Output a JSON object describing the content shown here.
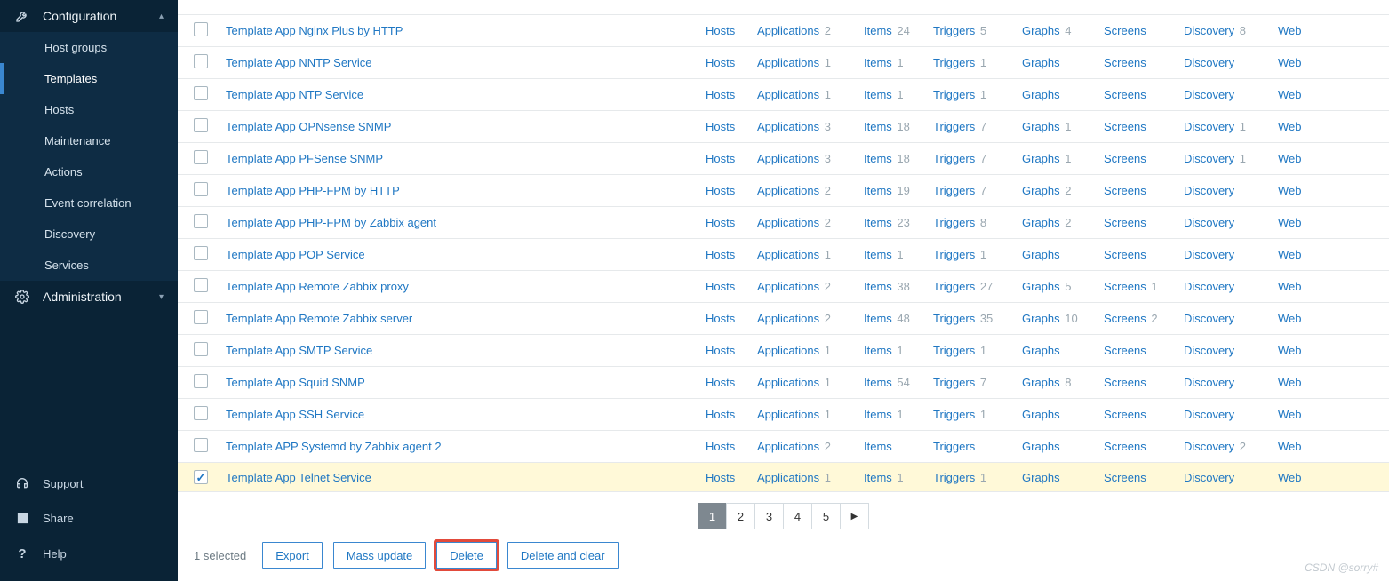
{
  "sidebar": {
    "sections": [
      {
        "label": "Configuration",
        "expanded": true,
        "items": [
          {
            "label": "Host groups",
            "active": false
          },
          {
            "label": "Templates",
            "active": true
          },
          {
            "label": "Hosts",
            "active": false
          },
          {
            "label": "Maintenance",
            "active": false
          },
          {
            "label": "Actions",
            "active": false
          },
          {
            "label": "Event correlation",
            "active": false
          },
          {
            "label": "Discovery",
            "active": false
          },
          {
            "label": "Services",
            "active": false
          }
        ]
      },
      {
        "label": "Administration",
        "expanded": false,
        "items": []
      }
    ],
    "footer": [
      {
        "label": "Support"
      },
      {
        "label": "Share"
      },
      {
        "label": "Help"
      }
    ]
  },
  "columns": {
    "hosts": "Hosts",
    "applications": "Applications",
    "items": "Items",
    "triggers": "Triggers",
    "graphs": "Graphs",
    "screens": "Screens",
    "discovery": "Discovery",
    "web": "Web"
  },
  "rows": [
    {
      "selected": false,
      "name": "Template App Nginx Plus by HTTP",
      "apps": 2,
      "items": 24,
      "triggers": 5,
      "graphs": 4,
      "screens": null,
      "discovery": 8
    },
    {
      "selected": false,
      "name": "Template App NNTP Service",
      "apps": 1,
      "items": 1,
      "triggers": 1,
      "graphs": null,
      "screens": null,
      "discovery": null
    },
    {
      "selected": false,
      "name": "Template App NTP Service",
      "apps": 1,
      "items": 1,
      "triggers": 1,
      "graphs": null,
      "screens": null,
      "discovery": null
    },
    {
      "selected": false,
      "name": "Template App OPNsense SNMP",
      "apps": 3,
      "items": 18,
      "triggers": 7,
      "graphs": 1,
      "screens": null,
      "discovery": 1
    },
    {
      "selected": false,
      "name": "Template App PFSense SNMP",
      "apps": 3,
      "items": 18,
      "triggers": 7,
      "graphs": 1,
      "screens": null,
      "discovery": 1
    },
    {
      "selected": false,
      "name": "Template App PHP-FPM by HTTP",
      "apps": 2,
      "items": 19,
      "triggers": 7,
      "graphs": 2,
      "screens": null,
      "discovery": null
    },
    {
      "selected": false,
      "name": "Template App PHP-FPM by Zabbix agent",
      "apps": 2,
      "items": 23,
      "triggers": 8,
      "graphs": 2,
      "screens": null,
      "discovery": null
    },
    {
      "selected": false,
      "name": "Template App POP Service",
      "apps": 1,
      "items": 1,
      "triggers": 1,
      "graphs": null,
      "screens": null,
      "discovery": null
    },
    {
      "selected": false,
      "name": "Template App Remote Zabbix proxy",
      "apps": 2,
      "items": 38,
      "triggers": 27,
      "graphs": 5,
      "screens": 1,
      "discovery": null
    },
    {
      "selected": false,
      "name": "Template App Remote Zabbix server",
      "apps": 2,
      "items": 48,
      "triggers": 35,
      "graphs": 10,
      "screens": 2,
      "discovery": null
    },
    {
      "selected": false,
      "name": "Template App SMTP Service",
      "apps": 1,
      "items": 1,
      "triggers": 1,
      "graphs": null,
      "screens": null,
      "discovery": null
    },
    {
      "selected": false,
      "name": "Template App Squid SNMP",
      "apps": 1,
      "items": 54,
      "triggers": 7,
      "graphs": 8,
      "screens": null,
      "discovery": null
    },
    {
      "selected": false,
      "name": "Template App SSH Service",
      "apps": 1,
      "items": 1,
      "triggers": 1,
      "graphs": null,
      "screens": null,
      "discovery": null
    },
    {
      "selected": false,
      "name": "Template APP Systemd by Zabbix agent 2",
      "apps": 2,
      "items": null,
      "triggers": null,
      "graphs": null,
      "screens": null,
      "discovery": 2
    },
    {
      "selected": true,
      "name": "Template App Telnet Service",
      "apps": 1,
      "items": 1,
      "triggers": 1,
      "graphs": null,
      "screens": null,
      "discovery": null
    }
  ],
  "pagination": {
    "pages": [
      "1",
      "2",
      "3",
      "4",
      "5"
    ],
    "current": 1,
    "next_glyph": "▶"
  },
  "actions": {
    "selected_text": "1 selected",
    "export": "Export",
    "mass_update": "Mass update",
    "delete": "Delete",
    "delete_clear": "Delete and clear"
  },
  "watermark": "CSDN @sorry#"
}
